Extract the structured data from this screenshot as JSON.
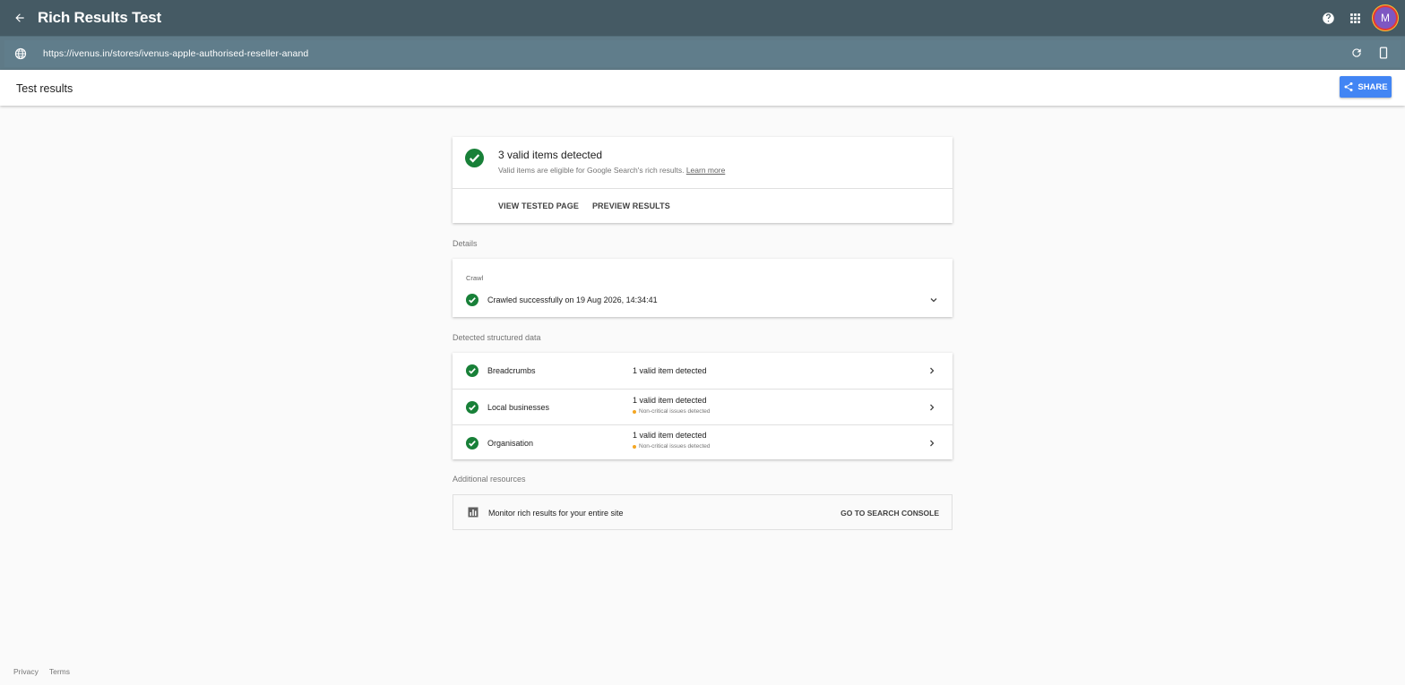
{
  "app": {
    "title": "Rich Results Test",
    "avatar_initial": "M"
  },
  "urlbar": {
    "url": "https://ivenus.in/stores/ivenus-apple-authorised-reseller-anand"
  },
  "results_header": {
    "title": "Test results",
    "share_label": "SHARE"
  },
  "summary": {
    "headline": "3 valid items detected",
    "subtext": "Valid items are eligible for Google Search's rich results.",
    "learn_more": "Learn more",
    "view_tested_page": "VIEW TESTED PAGE",
    "preview_results": "PREVIEW RESULTS"
  },
  "details": {
    "section_label": "Details",
    "crawl_label": "Crawl",
    "crawl_status": "Crawled successfully on 19 Aug 2026, 14:34:41"
  },
  "detected": {
    "section_label": "Detected structured data",
    "items": [
      {
        "name": "Breadcrumbs",
        "status": "1 valid item detected",
        "warning": ""
      },
      {
        "name": "Local businesses",
        "status": "1 valid item detected",
        "warning": "Non-critical issues detected"
      },
      {
        "name": "Organisation",
        "status": "1 valid item detected",
        "warning": "Non-critical issues detected"
      }
    ]
  },
  "resources": {
    "section_label": "Additional resources",
    "monitor_text": "Monitor rich results for your entire site",
    "go_label": "GO TO SEARCH CONSOLE"
  },
  "footer": {
    "privacy": "Privacy",
    "terms": "Terms"
  },
  "colors": {
    "appbar": "#455a64",
    "urlbar": "#607d8b",
    "success_green": "#188038",
    "share_blue": "#4285f4",
    "warning_orange": "#f4a623"
  }
}
